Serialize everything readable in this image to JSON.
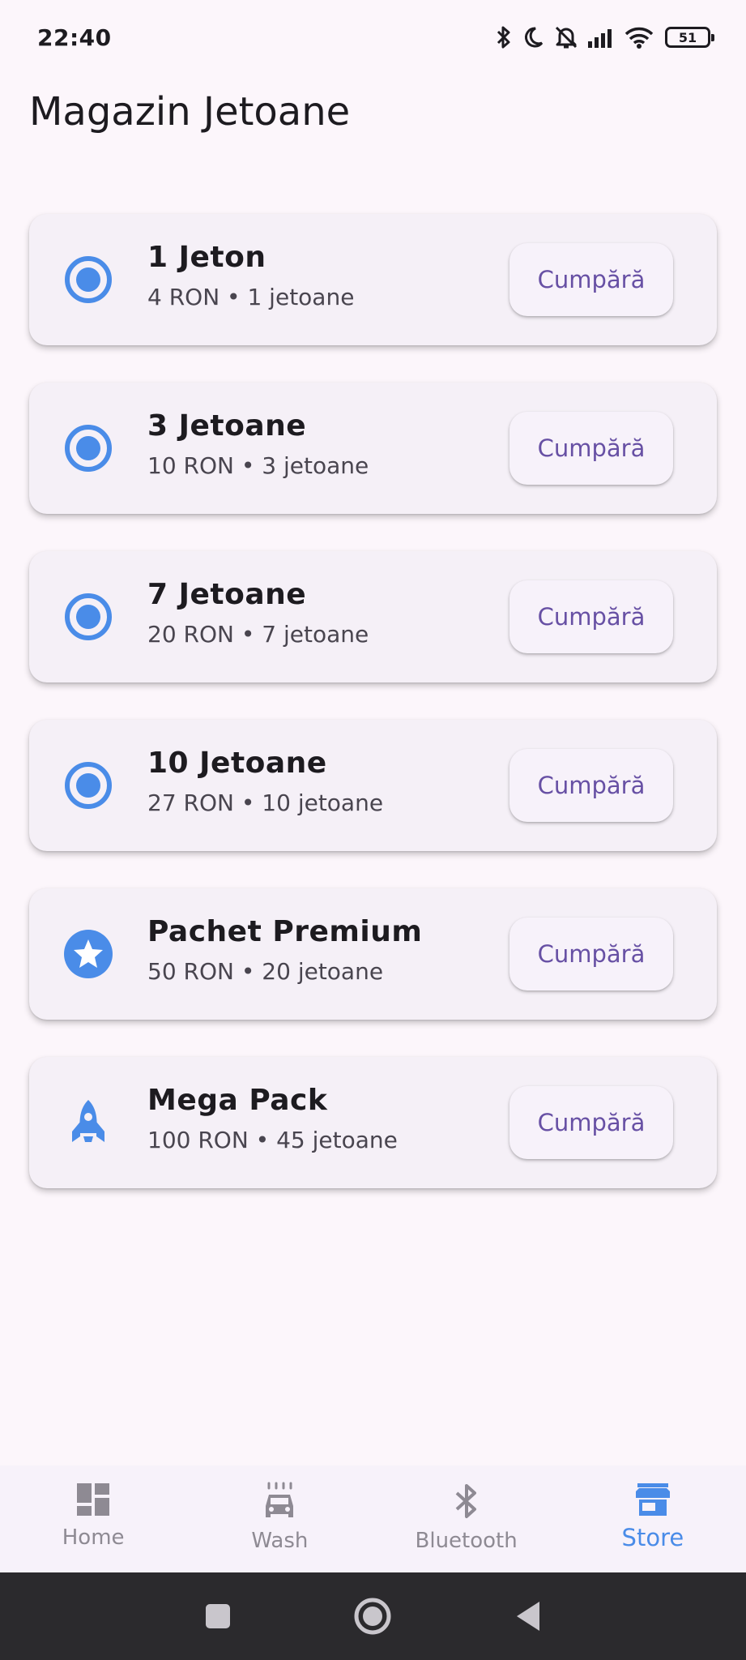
{
  "status_bar": {
    "time": "22:40",
    "battery": "51",
    "icons": [
      "bluetooth-icon",
      "moon-icon",
      "bell-off-icon",
      "signal-icon",
      "wifi-icon",
      "battery-icon"
    ]
  },
  "page": {
    "title": "Magazin Jetoane"
  },
  "products": [
    {
      "title": "1 Jeton",
      "subtitle": "4 RON • 1 jetoane",
      "icon": "radio-button-icon",
      "button": "Cumpără"
    },
    {
      "title": "3 Jetoane",
      "subtitle": "10 RON • 3 jetoane",
      "icon": "radio-button-icon",
      "button": "Cumpără"
    },
    {
      "title": "7 Jetoane",
      "subtitle": "20 RON • 7 jetoane",
      "icon": "radio-button-icon",
      "button": "Cumpără"
    },
    {
      "title": "10 Jetoane",
      "subtitle": "27 RON • 10 jetoane",
      "icon": "radio-button-icon",
      "button": "Cumpără"
    },
    {
      "title": "Pachet Premium",
      "subtitle": "50 RON • 20 jetoane",
      "icon": "star-badge-icon",
      "button": "Cumpără"
    },
    {
      "title": "Mega Pack",
      "subtitle": "100 RON • 45 jetoane",
      "icon": "rocket-icon",
      "button": "Cumpără"
    }
  ],
  "bottom_nav": {
    "items": [
      {
        "label": "Home",
        "icon": "dashboard-icon",
        "active": false
      },
      {
        "label": "Wash",
        "icon": "car-wash-icon",
        "active": false
      },
      {
        "label": "Bluetooth",
        "icon": "bluetooth-icon",
        "active": false
      },
      {
        "label": "Store",
        "icon": "store-icon",
        "active": true
      }
    ]
  },
  "colors": {
    "background": "#fcf6fb",
    "card": "#f5f0f7",
    "accent_icon": "#4a8ce8",
    "button_text": "#6750a4",
    "nav_inactive": "#8e8a93",
    "system_nav": "#2b2a2d"
  }
}
